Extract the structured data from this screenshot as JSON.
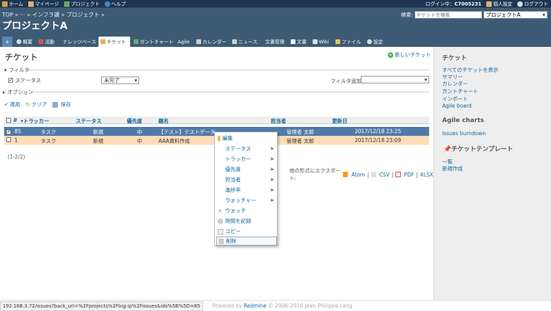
{
  "topbar": {
    "home": "ホーム",
    "mypage": "マイページ",
    "projects": "プロジェクト",
    "help": "ヘルプ",
    "login_prefix": "ログイン中：",
    "login_user": "C7005231",
    "settings": "個人設定",
    "logout": "ログアウト"
  },
  "header": {
    "breadcrumb": "TOP » ··· » インフラ課 » プロジェクト »",
    "title": "プロジェクトA",
    "search_label": "検索:",
    "search_placeholder": "チケットを検索",
    "project_select": "プロジェクトA"
  },
  "tabs": [
    {
      "label": "+"
    },
    {
      "label": "概要"
    },
    {
      "label": "活動"
    },
    {
      "label": "ナレッジベース"
    },
    {
      "label": "チケット"
    },
    {
      "label": "ガントチャート"
    },
    {
      "label": "Agile"
    },
    {
      "label": "カレンダー"
    },
    {
      "label": "ニュース"
    },
    {
      "label": "文書管理"
    },
    {
      "label": "文書"
    },
    {
      "label": "Wiki"
    },
    {
      "label": "ファイル"
    },
    {
      "label": "設定"
    }
  ],
  "main": {
    "title": "チケット",
    "new_issue": "新しいチケット",
    "filter_legend": "フィルタ",
    "status_label": "ステータス",
    "status_value": "未完了",
    "add_filter": "フィルタ追加",
    "options_legend": "オプション",
    "apply": "適用",
    "clear": "クリア",
    "save": "保存",
    "count": "(1-2/2)",
    "export_label": "他の形式にエクスポート:",
    "export_atom": "Atom",
    "export_csv": "CSV",
    "export_pdf": "PDF",
    "export_xlsx": "XLSX"
  },
  "table": {
    "headers": {
      "id": "#",
      "tracker": "トラッカー",
      "status": "ステータス",
      "priority": "優先度",
      "subject": "題名",
      "assignee": "担当者",
      "updated": "更新日"
    },
    "rows": [
      {
        "id": "85",
        "tracker": "タスク",
        "status": "新規",
        "priority": "中",
        "subject": "【テスト】テストデータ",
        "assignee": "管理者 太郎",
        "updated": "2017/12/18 23:25"
      },
      {
        "id": "1",
        "tracker": "タスク",
        "status": "新規",
        "priority": "中",
        "subject": "AAA資料作成",
        "assignee": "管理者 太郎",
        "updated": "2017/12/18 23:09"
      }
    ]
  },
  "context_menu": [
    {
      "label": "編集"
    },
    {
      "label": "ステータス"
    },
    {
      "label": "トラッカー"
    },
    {
      "label": "優先度"
    },
    {
      "label": "担当者"
    },
    {
      "label": "進捗率"
    },
    {
      "label": "ウォッチャー"
    },
    {
      "label": "ウォッチ"
    },
    {
      "label": "時間を記録"
    },
    {
      "label": "コピー"
    },
    {
      "label": "削除"
    }
  ],
  "sidebar": {
    "title": "チケット",
    "links": [
      "すべてのチケットを表示",
      "サマリー",
      "カレンダー",
      "ガントチャート",
      "インポート",
      "Agile board"
    ],
    "agile_title": "Agile charts",
    "agile_link": "Issues burndown",
    "template_title": "チケットテンプレート",
    "template_links": [
      "一覧",
      "新規作成"
    ]
  },
  "footer": {
    "status_url": "192.168.3.72/issues?back_url=%2Fprojects%2Fbig-ip%2Fissues&ids%5B%5D=85",
    "powered_prefix": "Powered by ",
    "powered_link": "Redmine",
    "powered_suffix": " © 2006-2016 Jean-Philippe Lang"
  }
}
